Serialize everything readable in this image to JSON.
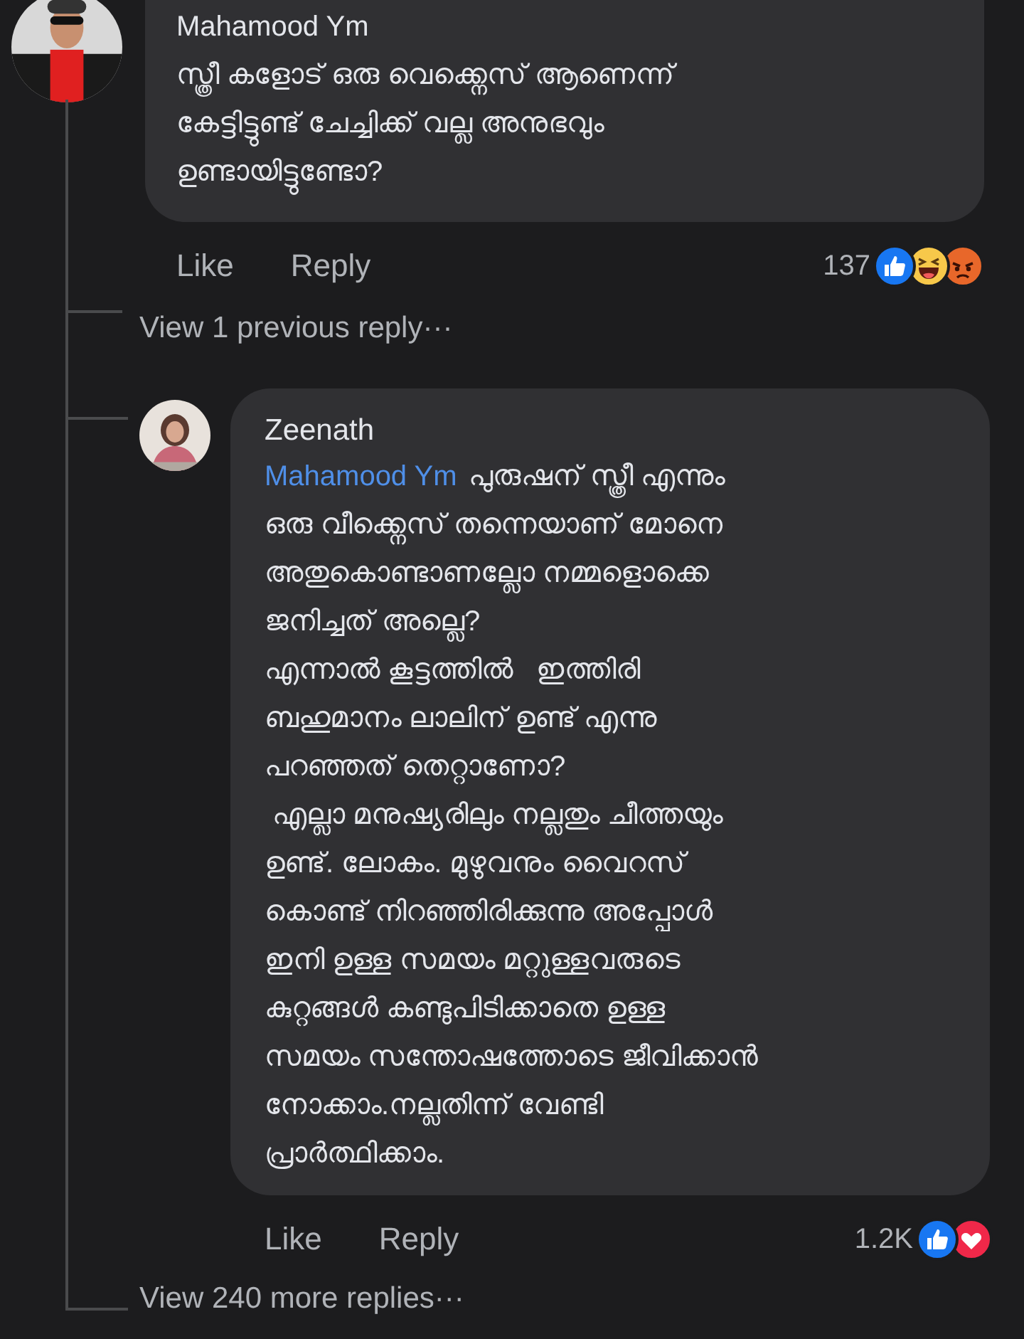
{
  "comment": {
    "author": "Mahamood Ym",
    "lines": [
      "സ്ത്രീ കളോട് ഒരു വെക്ക്നെസ് ആണെന്ന്",
      "കേട്ടിട്ടുണ്ട് ചേച്ചിക്ക് വല്ല അനുഭവും",
      "ഉണ്ടായിട്ടുണ്ടോ?"
    ],
    "actions": [
      "Like",
      "Reply"
    ],
    "reaction_count": "137",
    "reactions": [
      {
        "kind": "like"
      },
      {
        "kind": "haha"
      },
      {
        "kind": "angry"
      }
    ]
  },
  "view_previous": "View 1 previous reply···",
  "reply": {
    "author": "Zeenath",
    "mention": "Mahamood Ym",
    "lines": [
      "പുരുഷന് സ്ത്രീ എന്നും",
      "ഒരു വീക്ക്നെസ് തന്നെയാണ് മോനെ",
      "അതുകൊണ്ടാണല്ലോ നമ്മളൊക്കെ",
      "ജനിച്ചത് അല്ലെ?",
      "എന്നാൽ കൂട്ടത്തിൽ   ഇത്തിരി",
      "ബഹുമാനം ലാലിന് ഉണ്ട് എന്നു",
      "പറഞ്ഞത് തെറ്റാണോ?",
      " എല്ലാ മനുഷ്യരിലും നല്ലതും ചീത്തയും",
      "ഉണ്ട്. ലോകം. മുഴുവനും വൈറസ്",
      "കൊണ്ട് നിറഞ്ഞിരിക്കുന്നു അപ്പോൾ",
      "ഇനി ഉള്ള സമയം മറ്റുള്ളവരുടെ",
      "കുറ്റങ്ങൾ കണ്ടുപിടിക്കാതെ ഉള്ള",
      "സമയം സന്തോഷത്തോടെ ജീവിക്കാൻ",
      "നോക്കാം.നല്ലതിന്ന് വേണ്ടി",
      "പ്രാർത്ഥിക്കാം."
    ],
    "actions": [
      "Like",
      "Reply"
    ],
    "reaction_count": "1.2K",
    "reactions": [
      {
        "kind": "like"
      },
      {
        "kind": "love"
      }
    ]
  },
  "view_more": "View 240 more replies···"
}
